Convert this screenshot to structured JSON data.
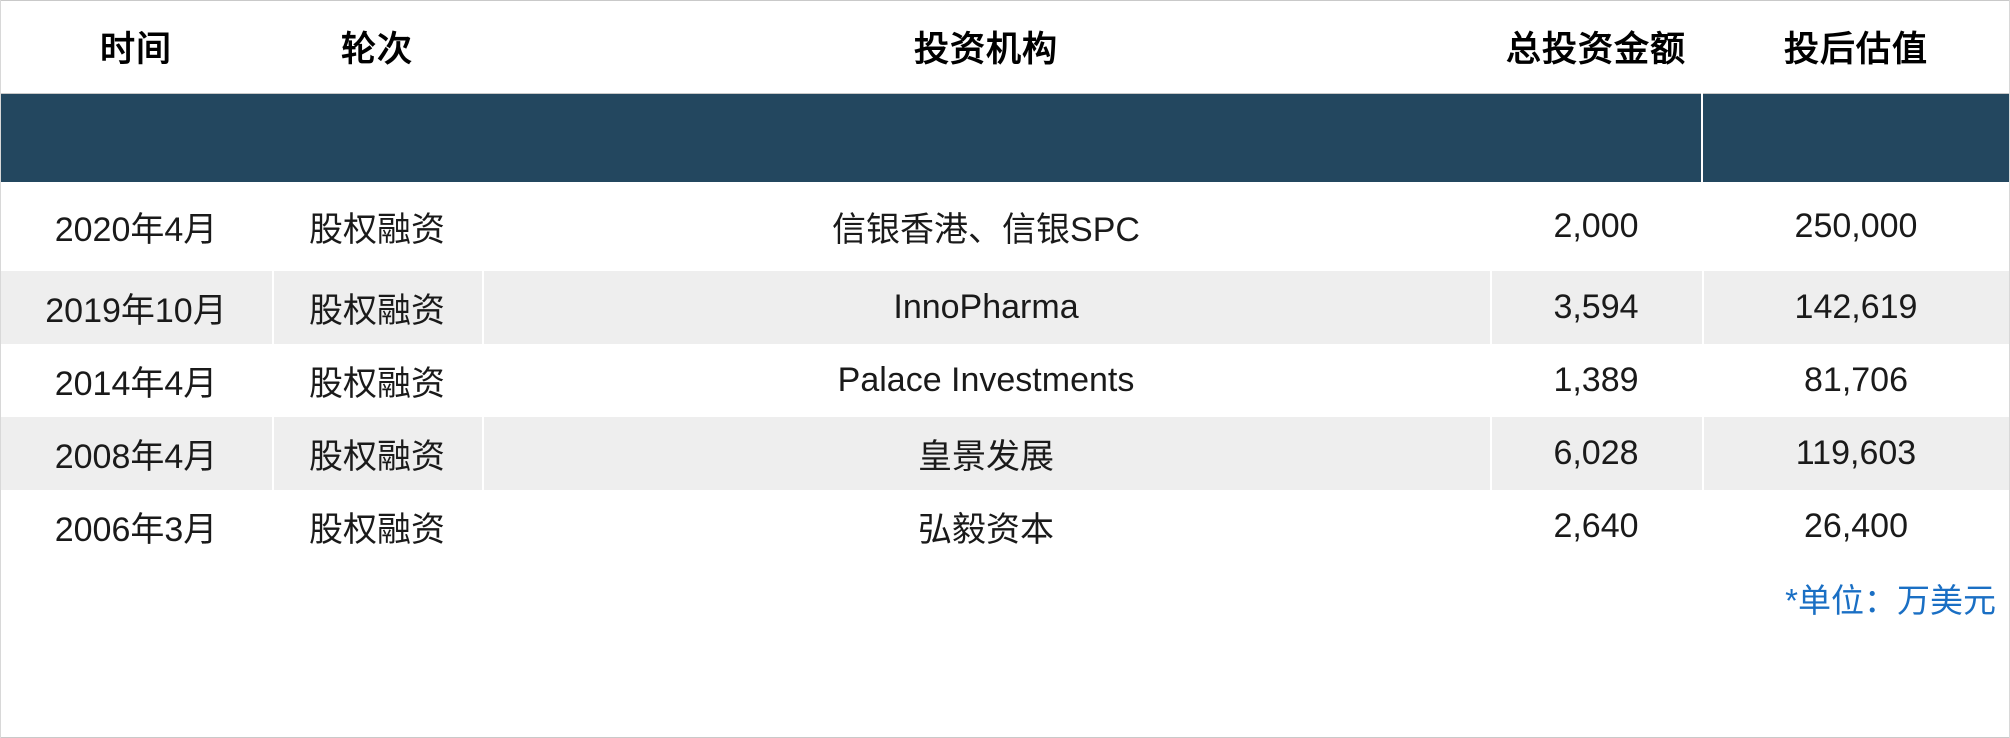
{
  "table": {
    "columns": [
      {
        "key": "time",
        "label": "时间"
      },
      {
        "key": "round",
        "label": "轮次"
      },
      {
        "key": "inst",
        "label": "投资机构"
      },
      {
        "key": "amt",
        "label": "总投资金额"
      },
      {
        "key": "val",
        "label": "投后估值"
      }
    ],
    "rows": [
      {
        "time": "2020年4月",
        "round": "股权融资",
        "inst": "信银香港、信银SPC",
        "amt": "2,000",
        "val": "250,000"
      },
      {
        "time": "2019年10月",
        "round": "股权融资",
        "inst": "InnoPharma",
        "amt": "3,594",
        "val": "142,619"
      },
      {
        "time": "2014年4月",
        "round": "股权融资",
        "inst": "Palace Investments",
        "amt": "1,389",
        "val": "81,706"
      },
      {
        "time": "2008年4月",
        "round": "股权融资",
        "inst": "皇景发展",
        "amt": "6,028",
        "val": "119,603"
      },
      {
        "time": "2006年3月",
        "round": "股权融资",
        "inst": "弘毅资本",
        "amt": "2,640",
        "val": "26,400"
      }
    ],
    "footnote": "*单位：万美元",
    "colors": {
      "band": "#23475f",
      "stripe": "#eeeeee",
      "footnote": "#1a6fc4",
      "text": "#1a1a1a",
      "header_text": "#000000"
    }
  }
}
